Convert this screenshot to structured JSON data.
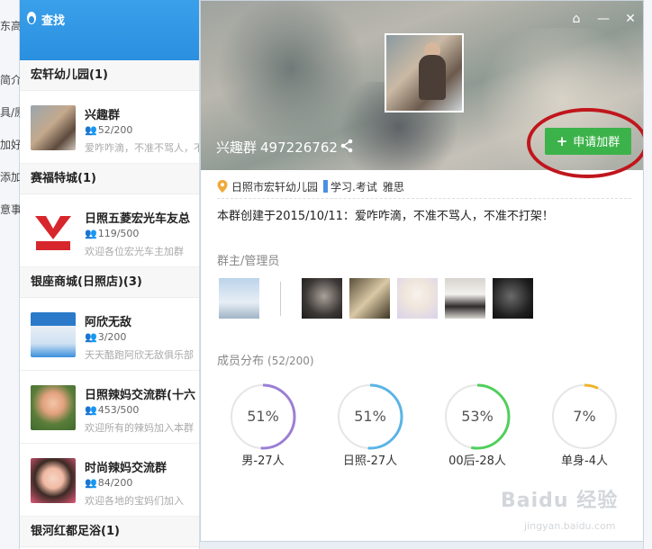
{
  "background": {
    "left_fragments": [
      "东高",
      "简介",
      "具/原",
      "加好",
      "添加",
      "意事"
    ]
  },
  "find_window": {
    "title": "查找",
    "sections": [
      {
        "title": "宏轩幼儿园(1)",
        "groups": [
          {
            "name": "兴趣群",
            "count": "52/200",
            "desc": "爱咋咋滴，不准不骂人，不准不打架！"
          }
        ]
      },
      {
        "title": "赛福特城(1)",
        "groups": [
          {
            "name": "日照五菱宏光车友总",
            "count": "119/500",
            "desc": "欢迎各位宏光车主加群"
          }
        ]
      },
      {
        "title": "银座商城(日照店)(3)",
        "groups": [
          {
            "name": "阿欣无敌",
            "count": "3/200",
            "desc": "天天酷跑阿欣无敌俱乐部"
          },
          {
            "name": "日照辣妈交流群(十六",
            "count": "453/500",
            "desc": "欢迎所有的辣妈加入本群"
          },
          {
            "name": "时尚辣妈交流群",
            "count": "84/200",
            "desc": "欢迎各地的宝妈们加入"
          }
        ]
      },
      {
        "title": "银河红都足浴(1)",
        "groups": []
      }
    ]
  },
  "detail": {
    "group_name": "兴趣群",
    "group_id": "497226762",
    "join_button": "申请加群",
    "location": "日照市宏轩幼儿园",
    "tags": [
      "学习.考试",
      "雅思"
    ],
    "intro": "本群创建于2015/10/11：爱咋咋滴，不准不骂人，不准不打架！",
    "admins_title": "群主/管理员",
    "members_title": "成员分布",
    "members_count": "(52/200)",
    "distribution": [
      {
        "percent": "51%",
        "value": 51,
        "label": "男-27人",
        "color": "#9b7fd4"
      },
      {
        "percent": "51%",
        "value": 51,
        "label": "日照-27人",
        "color": "#5ab4e6"
      },
      {
        "percent": "53%",
        "value": 53,
        "label": "00后-28人",
        "color": "#4fcf5b"
      },
      {
        "percent": "7%",
        "value": 7,
        "label": "单身-4人",
        "color": "#f0b429"
      }
    ]
  },
  "watermark": {
    "brand": "Baidu 经验",
    "url": "jingyan.baidu.com"
  }
}
